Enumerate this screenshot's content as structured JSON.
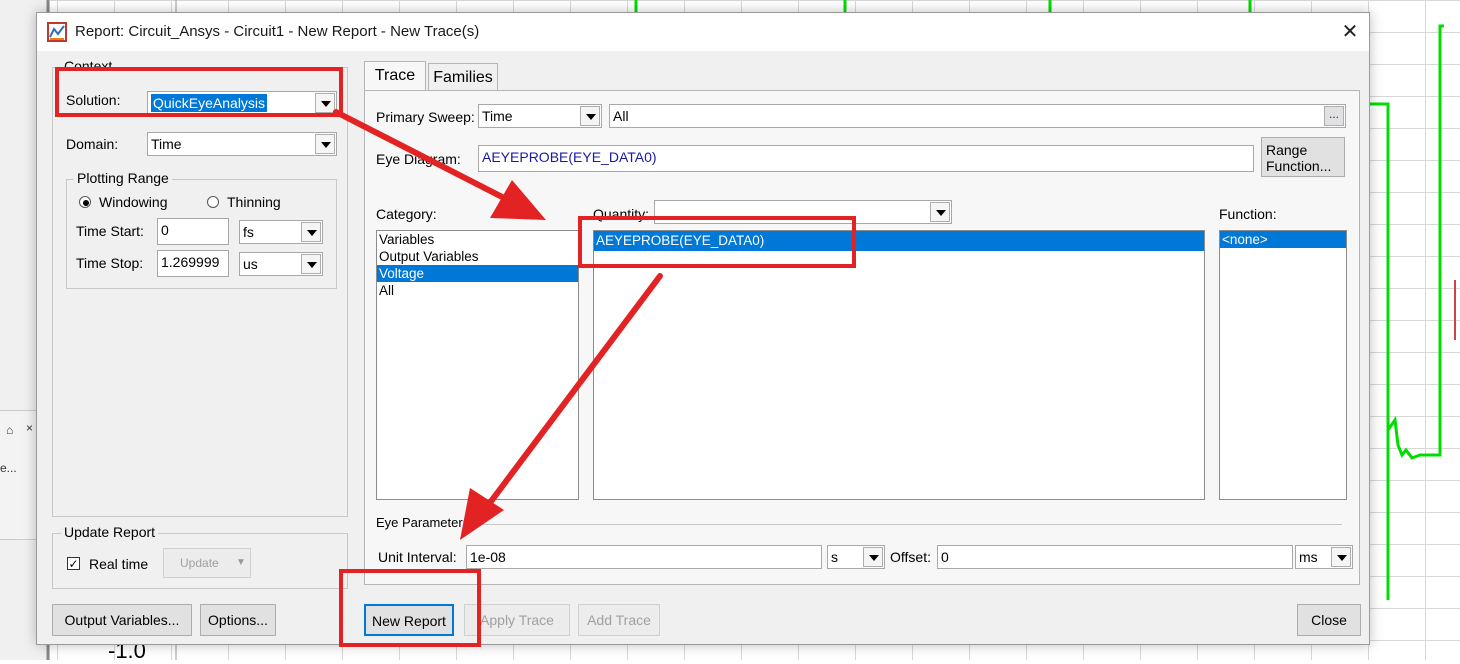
{
  "background": {
    "axis_label": "-1.0",
    "panel_pin": "⌂",
    "panel_close": "×",
    "panel_text": "e..."
  },
  "dialog": {
    "title": "Report: Circuit_Ansys - Circuit1 - New Report - New Trace(s)",
    "close_glyph": "✕",
    "context": {
      "group_label": "Context",
      "solution_label": "Solution:",
      "solution_value": "QuickEyeAnalysis",
      "domain_label": "Domain:",
      "domain_value": "Time",
      "plotting_range": {
        "group_label": "Plotting Range",
        "windowing": "Windowing",
        "thinning": "Thinning",
        "time_start_label": "Time Start:",
        "time_start_value": "0",
        "time_start_unit": "fs",
        "time_stop_label": "Time Stop:",
        "time_stop_value": "1.269999",
        "time_stop_unit": "us"
      }
    },
    "update_report": {
      "group_label": "Update Report",
      "realtime_label": "Real time",
      "update_button": "Update"
    },
    "tabs": [
      "Trace",
      "Families"
    ],
    "trace": {
      "primary_sweep_label": "Primary Sweep:",
      "primary_sweep_value": "Time",
      "sweep_all": "All",
      "ellipsis": "...",
      "eye_diagram_label": "Eye Diagram:",
      "eye_diagram_value": "AEYEPROBE(EYE_DATA0)",
      "range_function_button": "Range\nFunction...",
      "category_label": "Category:",
      "categories": [
        "Variables",
        "Output Variables",
        "Voltage",
        "All"
      ],
      "quantity_label": "Quantity:",
      "quantity_filter": "",
      "quantities": [
        "AEYEPROBE(EYE_DATA0)"
      ],
      "function_label": "Function:",
      "functions": [
        "<none>"
      ],
      "eye_params_label": "Eye Parameters",
      "unit_interval_label": "Unit Interval:",
      "unit_interval_value": "1e-08",
      "unit_interval_unit": "s",
      "offset_label": "Offset:",
      "offset_value": "0",
      "offset_unit": "ms"
    },
    "buttons": {
      "output_variables": "Output Variables...",
      "options": "Options...",
      "new_report": "New Report",
      "apply_trace": "Apply Trace",
      "add_trace": "Add Trace",
      "close": "Close"
    }
  },
  "colors": {
    "selection": "#0078d7",
    "annotation_red": "#e32323",
    "plot_green": "#00dd00"
  }
}
